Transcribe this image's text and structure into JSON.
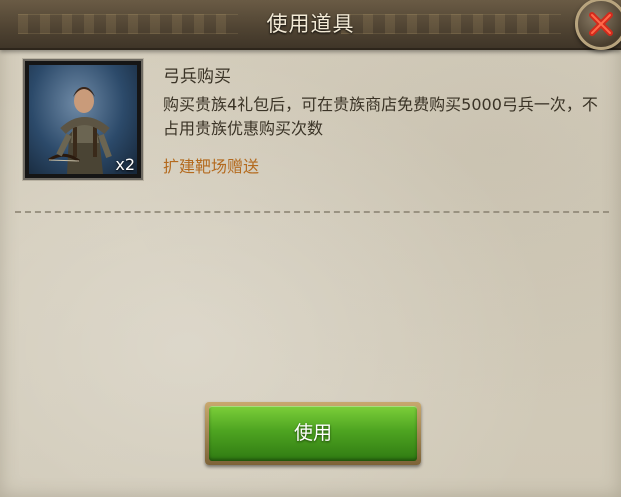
{
  "dialog": {
    "title": "使用道具"
  },
  "item": {
    "name": "弓兵购买",
    "quantity_label": "x2",
    "description": "购买贵族4礼包后，可在贵族商店免费购买5000弓兵一次，不占用贵族优惠购买次数",
    "source": "扩建靶场赠送"
  },
  "actions": {
    "use_label": "使用"
  },
  "colors": {
    "title_bar": "#4f4332",
    "panel_bg": "#d6cfbe",
    "source_text": "#b46a1e",
    "button_green": "#4ea421",
    "close_x": "#d32a1c"
  },
  "icons": {
    "close": "close-x-icon",
    "item": "archer-portrait-icon"
  }
}
